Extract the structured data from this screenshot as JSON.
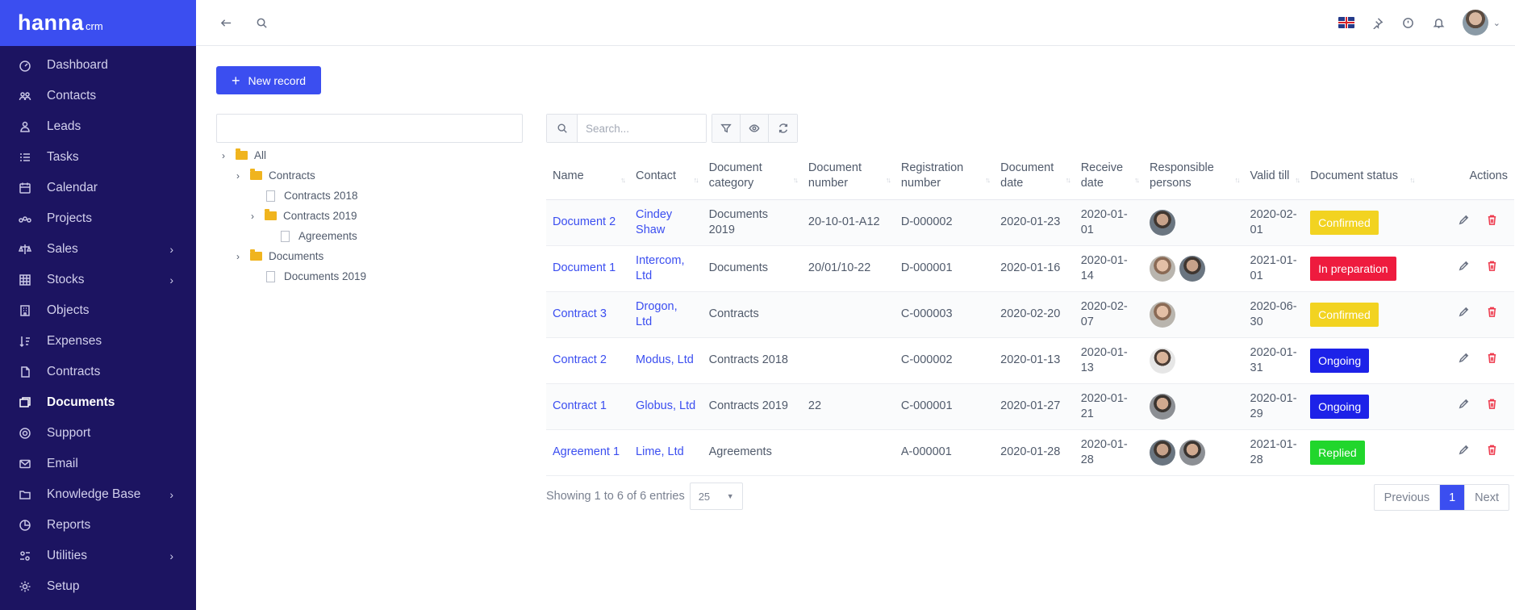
{
  "brand": {
    "name": "hanna",
    "sub": "crm"
  },
  "sidebar": {
    "items": [
      {
        "label": "Dashboard",
        "icon": "dashboard-icon"
      },
      {
        "label": "Contacts",
        "icon": "contacts-icon"
      },
      {
        "label": "Leads",
        "icon": "leads-icon"
      },
      {
        "label": "Tasks",
        "icon": "tasks-icon"
      },
      {
        "label": "Calendar",
        "icon": "calendar-icon"
      },
      {
        "label": "Projects",
        "icon": "projects-icon"
      },
      {
        "label": "Sales",
        "icon": "sales-icon",
        "has_children": true
      },
      {
        "label": "Stocks",
        "icon": "stocks-icon",
        "has_children": true
      },
      {
        "label": "Objects",
        "icon": "objects-icon"
      },
      {
        "label": "Expenses",
        "icon": "expenses-icon"
      },
      {
        "label": "Contracts",
        "icon": "contracts-icon"
      },
      {
        "label": "Documents",
        "icon": "documents-icon",
        "active": true
      },
      {
        "label": "Support",
        "icon": "support-icon"
      },
      {
        "label": "Email",
        "icon": "email-icon"
      },
      {
        "label": "Knowledge Base",
        "icon": "knowledge-base-icon",
        "has_children": true
      },
      {
        "label": "Reports",
        "icon": "reports-icon"
      },
      {
        "label": "Utilities",
        "icon": "utilities-icon",
        "has_children": true
      },
      {
        "label": "Setup",
        "icon": "setup-icon"
      }
    ]
  },
  "toolbar": {
    "new_record_label": "New record"
  },
  "tree": {
    "nodes": [
      {
        "label": "All",
        "type": "folder",
        "level": 0
      },
      {
        "label": "Contracts",
        "type": "folder",
        "level": 1
      },
      {
        "label": "Contracts 2018",
        "type": "file",
        "level": 2
      },
      {
        "label": "Contracts 2019",
        "type": "folder",
        "level": 2
      },
      {
        "label": "Agreements",
        "type": "file",
        "level": 3
      },
      {
        "label": "Documents",
        "type": "folder",
        "level": 1
      },
      {
        "label": "Documents 2019",
        "type": "file",
        "level": 2
      }
    ]
  },
  "table": {
    "search_placeholder": "Search...",
    "columns": [
      "Name",
      "Contact",
      "Document category",
      "Document number",
      "Registration number",
      "Document date",
      "Receive date",
      "Responsible persons",
      "Valid till",
      "Document status",
      "Actions"
    ],
    "rows": [
      {
        "name": "Document 2",
        "contact": "Cindey Shaw",
        "category": "Documents 2019",
        "doc_number": "20-10-01-A12",
        "reg_number": "D-000002",
        "doc_date": "2020-01-23",
        "receive_date": "2020-01-01",
        "persons": [
          "av3"
        ],
        "valid_till": "2020-02-01",
        "status": "Confirmed",
        "status_color": "#f2d321"
      },
      {
        "name": "Document 1",
        "contact": "Intercom, Ltd",
        "category": "Documents",
        "doc_number": "20/01/10-22",
        "reg_number": "D-000001",
        "doc_date": "2020-01-16",
        "receive_date": "2020-01-14",
        "persons": [
          "av2",
          "av3"
        ],
        "valid_till": "2021-01-01",
        "status": "In preparation",
        "status_color": "#ee1b3e"
      },
      {
        "name": "Contract 3",
        "contact": "Drogon, Ltd",
        "category": "Contracts",
        "doc_number": "",
        "reg_number": "C-000003",
        "doc_date": "2020-02-20",
        "receive_date": "2020-02-07",
        "persons": [
          "av2"
        ],
        "valid_till": "2020-06-30",
        "status": "Confirmed",
        "status_color": "#f2d321"
      },
      {
        "name": "Contract 2",
        "contact": "Modus, Ltd",
        "category": "Contracts 2018",
        "doc_number": "",
        "reg_number": "C-000002",
        "doc_date": "2020-01-13",
        "receive_date": "2020-01-13",
        "persons": [
          "av1"
        ],
        "valid_till": "2020-01-31",
        "status": "Ongoing",
        "status_color": "#1d22e8"
      },
      {
        "name": "Contract 1",
        "contact": "Globus, Ltd",
        "category": "Contracts 2019",
        "doc_number": "22",
        "reg_number": "C-000001",
        "doc_date": "2020-01-27",
        "receive_date": "2020-01-21",
        "persons": [
          "av4"
        ],
        "valid_till": "2020-01-29",
        "status": "Ongoing",
        "status_color": "#1d22e8"
      },
      {
        "name": "Agreement 1",
        "contact": "Lime, Ltd",
        "category": "Agreements",
        "doc_number": "",
        "reg_number": "A-000001",
        "doc_date": "2020-01-28",
        "receive_date": "2020-01-28",
        "persons": [
          "av3",
          "av4"
        ],
        "valid_till": "2021-01-28",
        "status": "Replied",
        "status_color": "#21d62c"
      }
    ]
  },
  "footer": {
    "entries_text": "Showing 1 to 6 of 6 entries",
    "page_size": "25",
    "pager": {
      "previous": "Previous",
      "current": "1",
      "next": "Next"
    }
  }
}
